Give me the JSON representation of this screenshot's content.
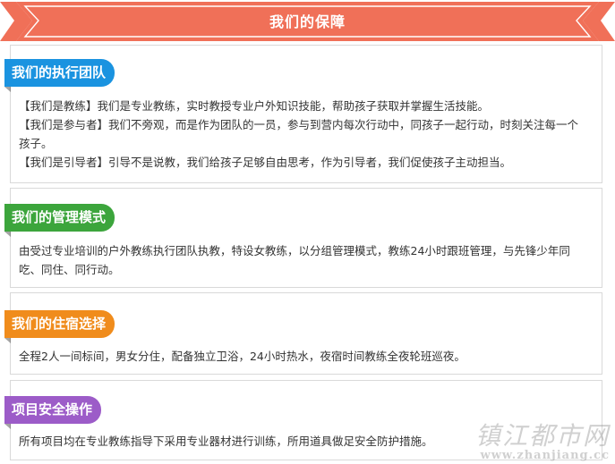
{
  "banner": {
    "title": "我们的保障",
    "color": "#f07058"
  },
  "sections": [
    {
      "tag": "我们的执行团队",
      "color": "#1a93e0",
      "lines": [
        "【我们是教练】我们是专业教练，实时教授专业户外知识技能，帮助孩子获取并掌握生活技能。",
        "【我们是参与者】我们不旁观，而是作为团队的一员，参与到营内每次行动中，同孩子一起行动，时刻关注每一个孩子。",
        "【我们是引导者】引导不是说教，我们给孩子足够自由思考，作为引导者，我们促使孩子主动担当。"
      ]
    },
    {
      "tag": "我们的管理模式",
      "color": "#3ca53c",
      "lines": [
        "由受过专业培训的户外教练执行团队执教，特设女教练，以分组管理模式，教练24小时跟班管理，与先锋少年同吃、同住、同行动。"
      ]
    },
    {
      "tag": "我们的住宿选择",
      "color": "#f08c1c",
      "lines": [
        "全程2人一间标间，男女分住，配备独立卫浴，24小时热水，夜宿时间教练全夜轮班巡夜。"
      ]
    },
    {
      "tag": "项目安全操作",
      "color": "#9c5cc8",
      "lines": [
        "所有项目均在专业教练指导下采用专业器材进行训练，所用道具做足安全防护措施。"
      ]
    }
  ],
  "watermark": {
    "cn": "镇江都市网",
    "url": "www.zhanjiang.cc"
  }
}
